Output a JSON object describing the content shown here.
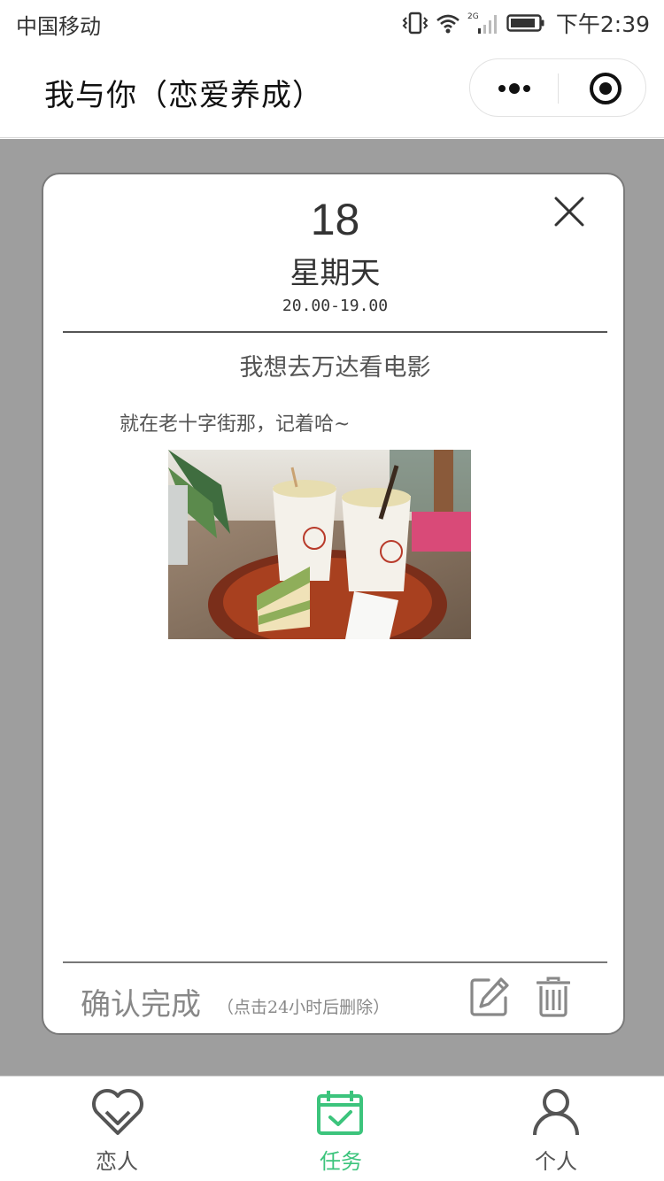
{
  "status_bar": {
    "carrier": "中国移动",
    "network": "2G",
    "time": "下午2:39"
  },
  "nav": {
    "title": "我与你（恋爱养成）"
  },
  "card": {
    "day": "18",
    "weekday": "星期天",
    "time_range": "20.00-19.00",
    "task_title": "我想去万达看电影",
    "task_desc": "就在老十字街那，记着哈~",
    "confirm_label": "确认完成",
    "confirm_hint": "（点击24小时后删除）"
  },
  "tabs": [
    {
      "label": "恋人",
      "icon": "heart-icon",
      "active": false
    },
    {
      "label": "任务",
      "icon": "calendar-check-icon",
      "active": true
    },
    {
      "label": "个人",
      "icon": "person-icon",
      "active": false
    }
  ],
  "colors": {
    "accent": "#3cc47c",
    "overlay": "#9e9e9e",
    "card_border": "#7a7a7a"
  }
}
